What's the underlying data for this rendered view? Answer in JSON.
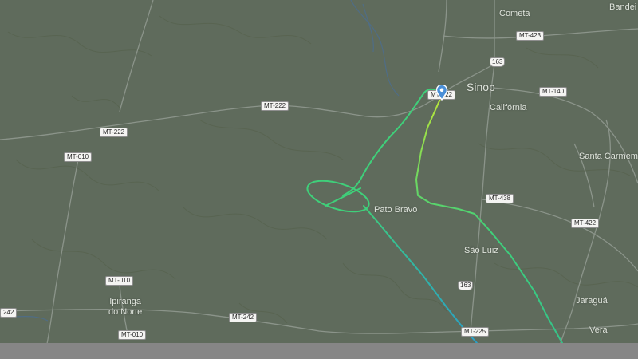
{
  "map": {
    "colors": {
      "land": "#5f6b5c",
      "road": "#8b948a",
      "river": "#4f6d86",
      "bottom_bar": "#868686",
      "track_start": "#b7e63a",
      "track_mid": "#3fd07a",
      "track_end": "#2aa0c8"
    },
    "towns": {
      "sinop": "Sinop",
      "cometa": "Cometa",
      "bandeira": "Bandei",
      "california": "Califórnia",
      "santa_carmem": "Santa Carmem",
      "pato_bravo": "Pato Bravo",
      "sao_luiz": "São Luiz",
      "ipiranga_line1": "Ipiranga",
      "ipiranga_line2": "do Norte",
      "jaragua": "Jaraguá",
      "vera": "Vera"
    },
    "roads": {
      "mt423": "MT-423",
      "br163_north": "163",
      "mt140": "MT-140",
      "mt222_sinop": "MT-222",
      "mt222_center": "MT-222",
      "mt222_west": "MT-222",
      "mt010_west": "MT-010",
      "mt438": "MT-438",
      "mt422": "MT-422",
      "br163_south": "163",
      "mt010_south": "MT-010",
      "mt242": "MT-242",
      "mt225": "MT-225",
      "mt010_bottom": "MT-010",
      "mt242_edge": "242"
    },
    "flight": {
      "marker": "aircraft-pin-icon"
    }
  }
}
